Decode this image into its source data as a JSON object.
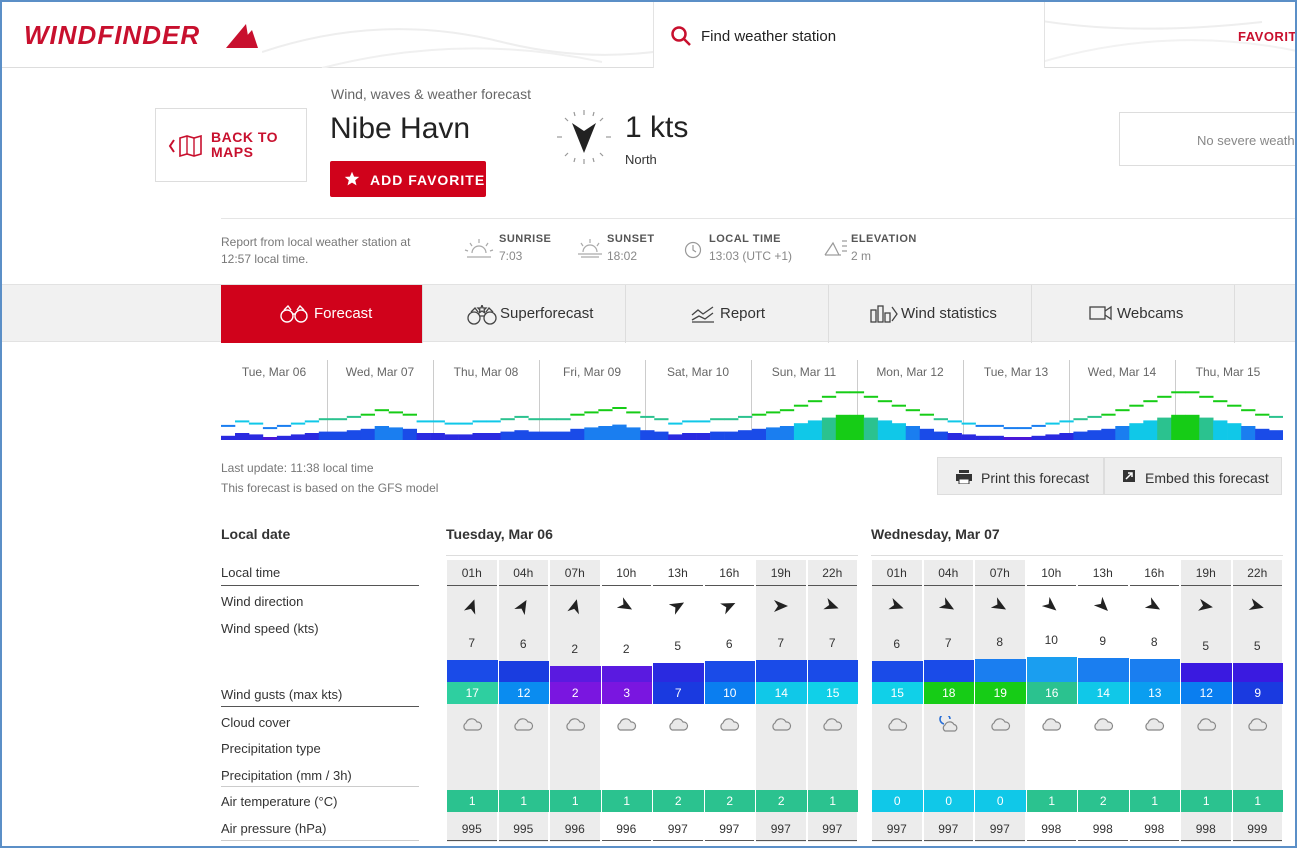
{
  "header": {
    "logo_text": "WINDFINDER",
    "search_placeholder": "Find weather station",
    "favorites_link": "FAVORITES"
  },
  "station": {
    "back_label_line1": "BACK TO",
    "back_label_line2": "MAPS",
    "subtitle": "Wind, waves & weather forecast",
    "name": "Nibe Havn",
    "add_favorite": "ADD FAVORITE",
    "wind_speed": "1 kts",
    "wind_direction": "North",
    "severe_weather": "No severe weath"
  },
  "info": {
    "report": "Report from local weather station at 12:57 local time.",
    "sunrise_label": "SUNRISE",
    "sunrise": "7:03",
    "sunset_label": "SUNSET",
    "sunset": "18:02",
    "localtime_label": "LOCAL TIME",
    "localtime": "13:03  (UTC +1)",
    "elevation_label": "ELEVATION",
    "elevation": "2 m"
  },
  "tabs": [
    {
      "label": "Forecast",
      "icon": "binoculars-icon",
      "active": true
    },
    {
      "label": "Superforecast",
      "icon": "binoculars-star-icon",
      "active": false
    },
    {
      "label": "Report",
      "icon": "report-chart-icon",
      "active": false
    },
    {
      "label": "Wind statistics",
      "icon": "statistics-icon",
      "active": false
    },
    {
      "label": "Webcams",
      "icon": "webcam-icon",
      "active": false
    }
  ],
  "overview_days": [
    "Tue, Mar 06",
    "Wed, Mar 07",
    "Thu, Mar 08",
    "Fri, Mar 09",
    "Sat, Mar 10",
    "Sun, Mar 11",
    "Mon, Mar 12",
    "Tue, Mar 13",
    "Wed, Mar 14",
    "Thu, Mar 15"
  ],
  "meta": {
    "last_update": "Last update: 11:38 local time",
    "model": "This forecast is based on the GFS model",
    "print": "Print this forecast",
    "embed": "Embed this forecast"
  },
  "row_labels": {
    "local_date": "Local date",
    "local_time": "Local time",
    "wind_direction": "Wind direction",
    "wind_speed": "Wind speed  (kts)",
    "wind_gusts": "Wind gusts  (max kts)",
    "cloud_cover": "Cloud cover",
    "precip_type": "Precipitation type",
    "precip": "Precipitation  (mm / 3h)",
    "air_temp": "Air temperature  (°C)",
    "air_pressure": "Air pressure  (hPa)"
  },
  "days": [
    {
      "title": "Tuesday, Mar 06",
      "hours": [
        "01h",
        "04h",
        "07h",
        "10h",
        "13h",
        "16h",
        "19h",
        "22h"
      ],
      "wind_dir_deg": [
        200,
        210,
        195,
        300,
        240,
        245,
        270,
        290
      ],
      "wind_speed": [
        7,
        6,
        2,
        2,
        5,
        6,
        7,
        7
      ],
      "wind_gusts": [
        17,
        12,
        2,
        3,
        7,
        10,
        14,
        15
      ],
      "gust_colors": [
        "#2ecfa0",
        "#0a8cf0",
        "#7a16e0",
        "#7a16e0",
        "#1a3ae0",
        "#0a7ef0",
        "#10c8e8",
        "#10d0e8"
      ],
      "bar_colors": [
        "#1a4be8",
        "#1a3de0",
        "#5a1ae0",
        "#5a1ae0",
        "#2a2ae0",
        "#1a4be8",
        "#1a4be8",
        "#1a4be8"
      ],
      "cloud_icons": [
        "cloud",
        "cloud",
        "cloud",
        "cloud",
        "cloud",
        "cloud",
        "cloud",
        "cloud"
      ],
      "air_temp": [
        1,
        1,
        1,
        1,
        2,
        2,
        2,
        1
      ],
      "air_pressure": [
        995,
        995,
        996,
        996,
        997,
        997,
        997,
        997
      ]
    },
    {
      "title": "Wednesday, Mar 07",
      "hours": [
        "01h",
        "04h",
        "07h",
        "10h",
        "13h",
        "16h",
        "19h",
        "22h"
      ],
      "wind_dir_deg": [
        290,
        300,
        300,
        310,
        315,
        300,
        280,
        285
      ],
      "wind_speed": [
        6,
        7,
        8,
        10,
        9,
        8,
        5,
        5
      ],
      "wind_gusts": [
        15,
        18,
        19,
        16,
        14,
        13,
        12,
        9
      ],
      "gust_colors": [
        "#10d0e8",
        "#16cc16",
        "#16cc16",
        "#2bc28f",
        "#10c8e8",
        "#0a9ef0",
        "#0a7ef0",
        "#1a3ae0"
      ],
      "bar_colors": [
        "#1a4be8",
        "#1a4be8",
        "#1a7ef0",
        "#1a9ef0",
        "#1a7ef0",
        "#1a7ef0",
        "#3a1ae0",
        "#3a1ae0"
      ],
      "cloud_icons": [
        "cloud",
        "partly-cloudy",
        "cloud",
        "cloud",
        "cloud",
        "cloud",
        "cloud",
        "cloud"
      ],
      "air_temp": [
        0,
        0,
        0,
        1,
        2,
        1,
        1,
        1
      ],
      "temp_colors": [
        "#10c8e8",
        "#10c8e8",
        "#10c8e8",
        "#2bc28f",
        "#2bc28f",
        "#2bc28f",
        "#2bc28f",
        "#2bc28f"
      ],
      "air_pressure": [
        997,
        997,
        997,
        998,
        998,
        998,
        998,
        999
      ]
    }
  ],
  "colors": {
    "brand": "#d0021b",
    "temp_green": "#2bc28f"
  }
}
